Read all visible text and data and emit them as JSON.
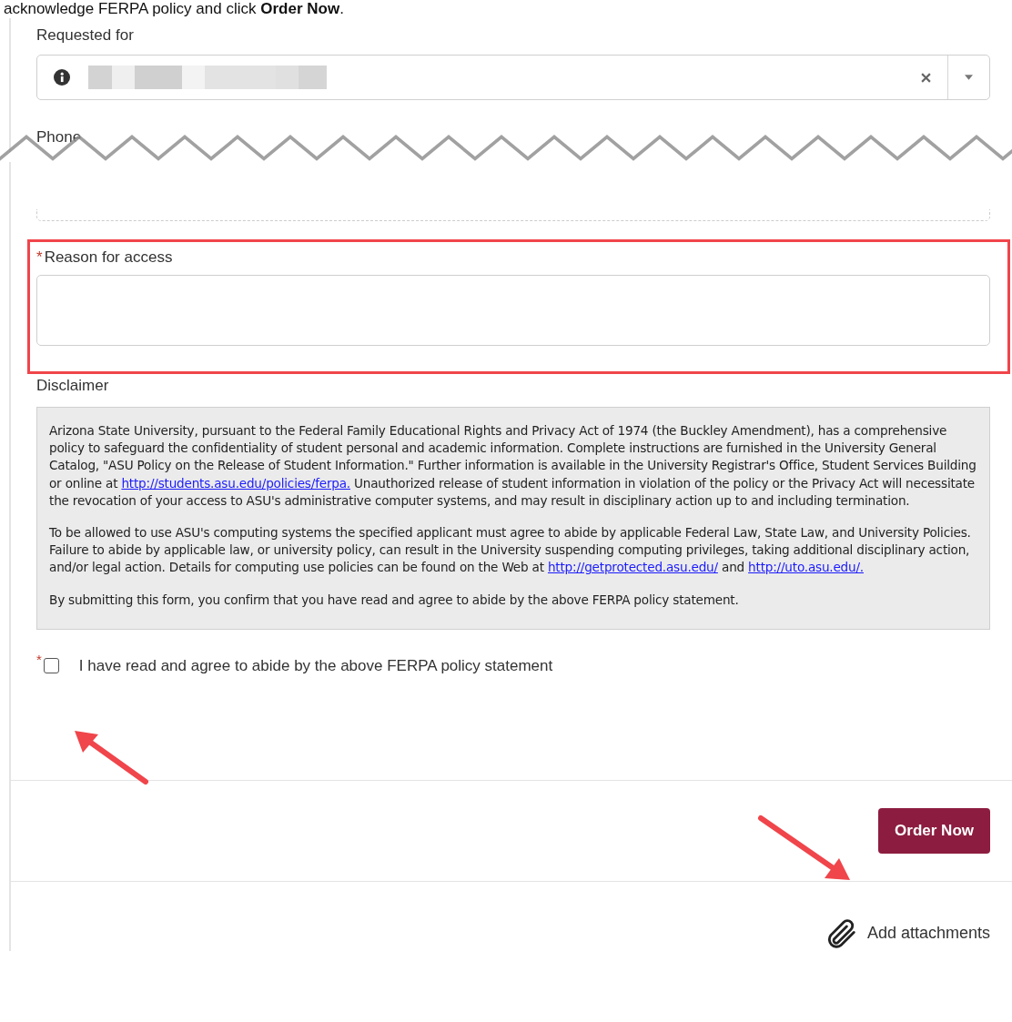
{
  "instruction": "acknowledge FERPA policy and click **Order Now**.",
  "requested_for": {
    "label": "Requested for"
  },
  "phone": {
    "label": "Phone"
  },
  "reason": {
    "label": "Reason for access",
    "required_mark": "*",
    "highlighted": true
  },
  "disclaimer": {
    "label": "Disclaimer",
    "paragraphs": [
      [
        {
          "kind": "text",
          "text": "Arizona State University, pursuant to the Federal Family Educational Rights and Privacy Act of 1974 (the Buckley Amendment), has a comprehensive policy to safeguard the confidentiality of student personal and academic information. Complete instructions are furnished in the University General Catalog, \"ASU Policy on the Release of Student Information.\" Further information is available in the University Registrar's Office, Student Services Building or online at "
        },
        {
          "kind": "link",
          "text": "http://students.asu.edu/policies/ferpa."
        },
        {
          "kind": "text",
          "text": " Unauthorized release of student information in violation of the policy or the Privacy Act will necessitate the revocation of your access to ASU's administrative computer systems, and may result in disciplinary action up to and including termination."
        }
      ],
      [
        {
          "kind": "text",
          "text": "To be allowed to use ASU's computing systems the specified applicant must agree to abide by applicable Federal Law, State Law, and University Policies. Failure to abide by applicable law, or university policy, can result in the University suspending computing privileges, taking additional disciplinary action, and/or legal action. Details for computing use policies can be found on the Web at "
        },
        {
          "kind": "link",
          "text": "http://getprotected.asu.edu/"
        },
        {
          "kind": "text",
          "text": " and "
        },
        {
          "kind": "link",
          "text": "http://uto.asu.edu/."
        }
      ],
      [
        {
          "kind": "text",
          "text": "By submitting this form, you confirm that you have read and agree to abide by the above FERPA policy statement."
        }
      ]
    ]
  },
  "agreement": {
    "label": "I have read and agree to abide by the above FERPA policy statement",
    "required_mark": "*",
    "checked": false
  },
  "order_button": {
    "label": "Order Now"
  },
  "attachments": {
    "label": "Add attachments"
  }
}
